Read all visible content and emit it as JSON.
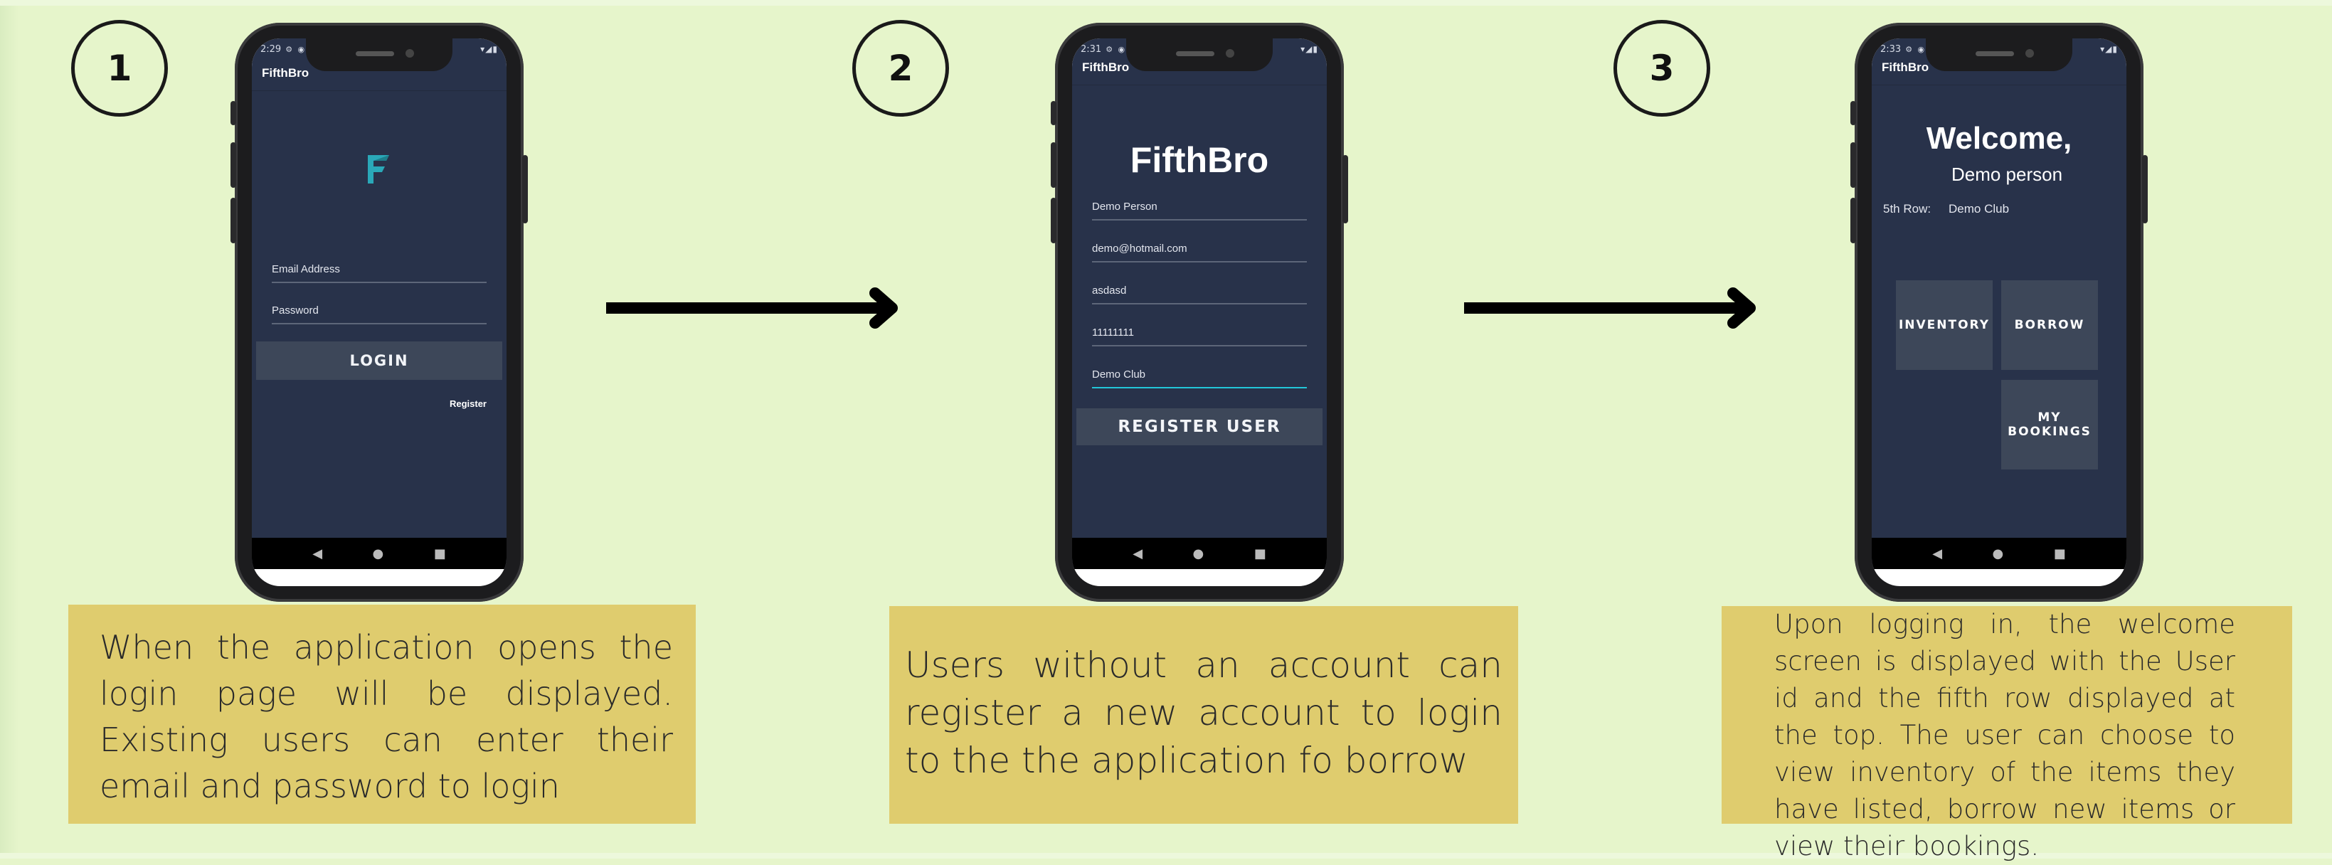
{
  "steps": [
    {
      "number": "1",
      "status_time": "2:29",
      "app_title": "FifthBro",
      "logo_letter": "F",
      "email_placeholder": "Email Address",
      "password_placeholder": "Password",
      "login_label": "LOGIN",
      "register_link": "Register",
      "caption": "When the application opens the login page will be displayed. Existing users can enter their email and password to login"
    },
    {
      "number": "2",
      "status_time": "2:31",
      "app_title": "FifthBro",
      "heading": "FifthBro",
      "fields": [
        "Demo Person",
        "demo@hotmail.com",
        "asdasd",
        "11111111",
        "Demo Club"
      ],
      "register_button": "REGISTER USER",
      "caption": "Users without an account can register a new account to login to the the application fo borrow"
    },
    {
      "number": "3",
      "status_time": "2:33",
      "app_title": "FifthBro",
      "welcome": "Welcome,",
      "user_name": "Demo person",
      "row_label": "5th Row:",
      "row_value": "Demo Club",
      "inventory_label": "INVENTORY",
      "borrow_label": "BORROW",
      "bookings_label": "MY BOOKINGS",
      "caption": "Upon logging in, the welcome screen is displayed with the User id and the fifth row displayed at the top. The user can choose to view inventory of the items they have listed, borrow new items or view their bookings."
    }
  ],
  "nav": {
    "back": "◀",
    "home": "●",
    "recents": "■"
  },
  "colors": {
    "background": "#e6f5cb",
    "caption_bg": "#dfcc6e",
    "app_bg": "#28324a",
    "button_bg": "#3d4759",
    "accent": "#22c6d8",
    "logo": "#2aa8b8"
  }
}
